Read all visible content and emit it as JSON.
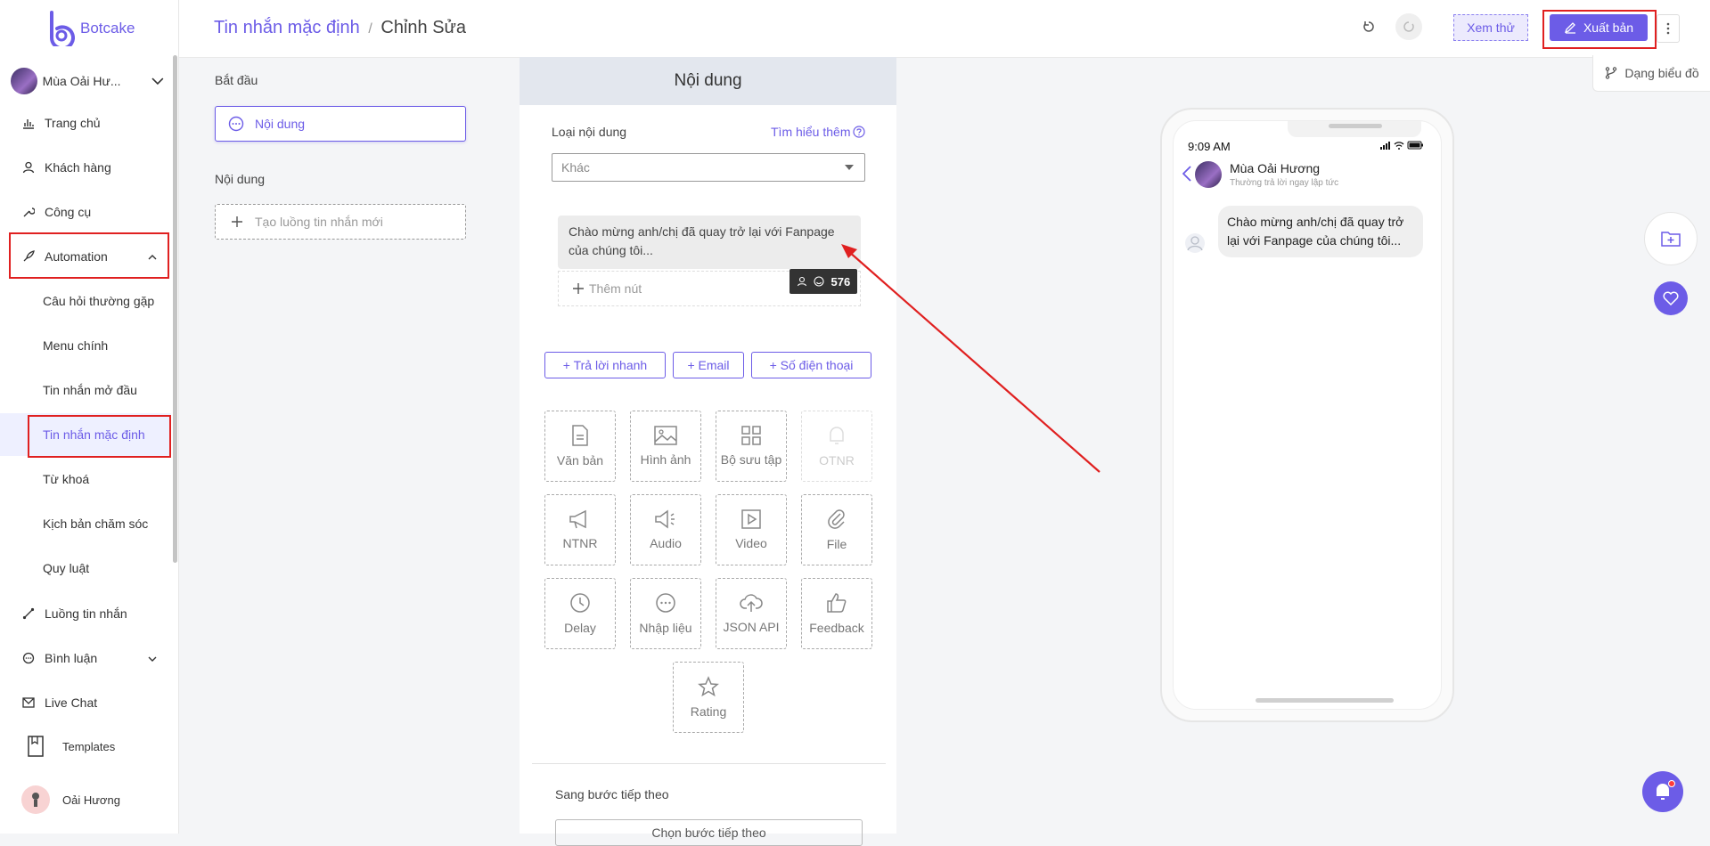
{
  "app": {
    "name": "Botcake"
  },
  "sidebar": {
    "page_name": "Mùa Oải Hư...",
    "items": [
      {
        "label": "Trang chủ"
      },
      {
        "label": "Khách hàng"
      },
      {
        "label": "Công cụ"
      },
      {
        "label": "Automation"
      },
      {
        "label": "Luồng tin nhắn"
      },
      {
        "label": "Bình luận"
      },
      {
        "label": "Live Chat"
      },
      {
        "label": "Templates"
      }
    ],
    "automation_sub": [
      {
        "label": "Câu hỏi thường gặp"
      },
      {
        "label": "Menu chính"
      },
      {
        "label": "Tin nhắn mở đầu"
      },
      {
        "label": "Tin nhắn mặc định"
      },
      {
        "label": "Từ khoá"
      },
      {
        "label": "Kịch bản chăm sóc"
      },
      {
        "label": "Quy luật"
      }
    ],
    "user_name": "Oải Hương"
  },
  "header": {
    "breadcrumb_parent": "Tin nhắn mặc định",
    "breadcrumb_sep": "/",
    "breadcrumb_current": "Chỉnh Sửa",
    "preview_label": "Xem thử",
    "publish_label": "Xuất bản"
  },
  "flow": {
    "start_label": "Bắt đầu",
    "start_node": "Nội dung",
    "content_label": "Nội dung",
    "new_flow_placeholder": "Tạo luồng tin nhắn mới"
  },
  "editor": {
    "title": "Nội dung",
    "content_type_label": "Loại nội dung",
    "learn_more": "Tìm hiểu thêm",
    "content_type_value": "Khác",
    "message_text": "Chào mừng anh/chị đã quay trở lại với Fanpage của chúng tôi...",
    "char_count": "576",
    "add_button": "Thêm nút",
    "quick_buttons": [
      "+ Trả lời nhanh",
      "+ Email",
      "+ Số điện thoại"
    ],
    "tiles": [
      {
        "label": "Văn bản",
        "icon": "document-icon"
      },
      {
        "label": "Hình ảnh",
        "icon": "image-icon"
      },
      {
        "label": "Bộ sưu tập",
        "icon": "grid-icon"
      },
      {
        "label": "OTNR",
        "icon": "bell-icon"
      },
      {
        "label": "NTNR",
        "icon": "megaphone-icon"
      },
      {
        "label": "Audio",
        "icon": "speaker-icon"
      },
      {
        "label": "Video",
        "icon": "play-icon"
      },
      {
        "label": "File",
        "icon": "paperclip-icon"
      },
      {
        "label": "Delay",
        "icon": "clock-icon"
      },
      {
        "label": "Nhập liệu",
        "icon": "chat-icon"
      },
      {
        "label": "JSON API",
        "icon": "cloud-upload-icon"
      },
      {
        "label": "Feedback",
        "icon": "thumbs-up-icon"
      },
      {
        "label": "Rating",
        "icon": "star-icon"
      }
    ],
    "next_step_label": "Sang bước tiếp theo",
    "next_step_button": "Chọn bước tiếp theo"
  },
  "preview": {
    "diagram_toggle": "Dạng biểu đồ",
    "time": "9:09 AM",
    "page_name": "Mùa Oải Hương",
    "reply_status": "Thường trả lời ngay lập tức",
    "message": "Chào mừng anh/chị đã quay trở lại với Fanpage của chúng tôi..."
  },
  "colors": {
    "accent": "#6c5ce7",
    "highlight": "#e02020"
  }
}
